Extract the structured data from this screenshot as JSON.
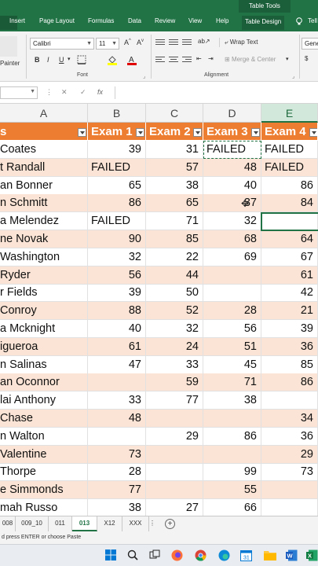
{
  "ribbon": {
    "context_group": "Table Tools",
    "tabs": [
      "Insert",
      "Page Layout",
      "Formulas",
      "Data",
      "Review",
      "View",
      "Help",
      "Table Design"
    ],
    "tell": "Tell",
    "painter": "Painter",
    "font_name": "Calibri",
    "font_size": "11",
    "wrap_text": "Wrap Text",
    "merge_center": "Merge & Center",
    "number_format": "Gener",
    "group_font": "Font",
    "group_alignment": "Alignment",
    "bold": "B",
    "italic": "I",
    "underline": "U"
  },
  "formula_bar": {
    "fx": "fx",
    "cancel": "✕",
    "enter": "✓",
    "content": ""
  },
  "columns": [
    "A",
    "B",
    "C",
    "D",
    "E"
  ],
  "selected_column": "E",
  "table": {
    "headers": [
      "s",
      "Exam 1",
      "Exam 2",
      "Exam 3",
      "Exam 4"
    ],
    "rows": [
      [
        "Coates",
        "39",
        "31",
        "FAILED",
        "FAILED"
      ],
      [
        "t Randall",
        "FAILED",
        "57",
        "48",
        "FAILED"
      ],
      [
        "an Bonner",
        "65",
        "38",
        "40",
        "86"
      ],
      [
        "n Schmitt",
        "86",
        "65",
        "37",
        "84"
      ],
      [
        "a Melendez",
        "FAILED",
        "71",
        "32",
        ""
      ],
      [
        "ne Novak",
        "90",
        "85",
        "68",
        "64"
      ],
      [
        " Washington",
        "32",
        "22",
        "69",
        "67"
      ],
      [
        " Ryder",
        "56",
        "44",
        "",
        "61"
      ],
      [
        "r Fields",
        "39",
        "50",
        "",
        "42"
      ],
      [
        "Conroy",
        "88",
        "52",
        "28",
        "21"
      ],
      [
        "a Mcknight",
        "40",
        "32",
        "56",
        "39"
      ],
      [
        "igueroa",
        "61",
        "24",
        "51",
        "36"
      ],
      [
        "n Salinas",
        "47",
        "33",
        "45",
        "85"
      ],
      [
        "an Oconnor",
        "",
        "59",
        "71",
        "86"
      ],
      [
        "lai Anthony",
        "33",
        "77",
        "38",
        ""
      ],
      [
        " Chase",
        "48",
        "",
        "",
        "34"
      ],
      [
        "n Walton",
        "",
        "29",
        "86",
        "36"
      ],
      [
        "Valentine",
        "73",
        "",
        "",
        "29"
      ],
      [
        "Thorpe",
        "28",
        "",
        "99",
        "73"
      ],
      [
        "e Simmonds",
        "77",
        "",
        "55",
        ""
      ],
      [
        "mah Russo",
        "38",
        "27",
        "66",
        ""
      ]
    ]
  },
  "sheets": [
    "008",
    "009_10",
    "011",
    "013",
    "X12",
    "XXX"
  ],
  "active_sheet": "013",
  "status_text": "d press ENTER or choose Paste",
  "colors": {
    "excel_green": "#217346",
    "table_header": "#ed7d31",
    "band": "#fbe4d5"
  }
}
